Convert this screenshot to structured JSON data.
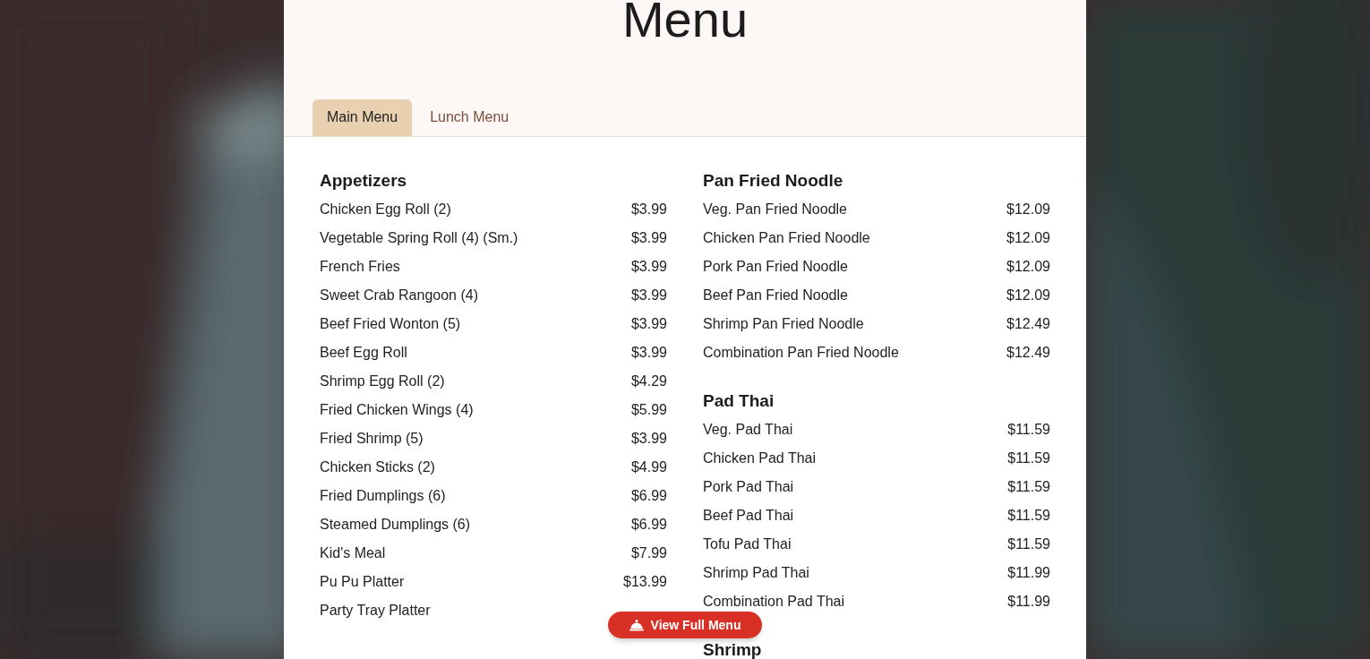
{
  "title": "Menu",
  "tabs": [
    {
      "label": "Main Menu",
      "selected": true
    },
    {
      "label": "Lunch Menu",
      "selected": false
    }
  ],
  "columns": [
    {
      "sections": [
        {
          "title": "Appetizers",
          "items": [
            {
              "name": "Chicken Egg Roll (2)",
              "price": "$3.99"
            },
            {
              "name": "Vegetable Spring Roll (4) (Sm.)",
              "price": "$3.99"
            },
            {
              "name": "French Fries",
              "price": "$3.99"
            },
            {
              "name": "Sweet Crab Rangoon (4)",
              "price": "$3.99"
            },
            {
              "name": "Beef Fried Wonton (5)",
              "price": "$3.99"
            },
            {
              "name": "Beef Egg Roll",
              "price": "$3.99"
            },
            {
              "name": "Shrimp Egg Roll (2)",
              "price": "$4.29"
            },
            {
              "name": "Fried Chicken Wings (4)",
              "price": "$5.99"
            },
            {
              "name": "Fried Shrimp (5)",
              "price": "$3.99"
            },
            {
              "name": "Chicken Sticks (2)",
              "price": "$4.99"
            },
            {
              "name": "Fried Dumplings (6)",
              "price": "$6.99"
            },
            {
              "name": "Steamed Dumplings (6)",
              "price": "$6.99"
            },
            {
              "name": "Kid's Meal",
              "price": "$7.99"
            },
            {
              "name": "Pu Pu Platter",
              "price": "$13.99"
            },
            {
              "name": "Party Tray Platter"
            }
          ]
        }
      ]
    },
    {
      "sections": [
        {
          "title": "Pan Fried Noodle",
          "items": [
            {
              "name": "Veg. Pan Fried Noodle",
              "price": "$12.09"
            },
            {
              "name": "Chicken Pan Fried Noodle",
              "price": "$12.09"
            },
            {
              "name": "Pork Pan Fried Noodle",
              "price": "$12.09"
            },
            {
              "name": "Beef Pan Fried Noodle",
              "price": "$12.09"
            },
            {
              "name": "Shrimp Pan Fried Noodle",
              "price": "$12.49"
            },
            {
              "name": "Combination Pan Fried Noodle",
              "price": "$12.49"
            }
          ]
        },
        {
          "title": "Pad Thai",
          "items": [
            {
              "name": "Veg. Pad Thai",
              "price": "$11.59"
            },
            {
              "name": "Chicken Pad Thai",
              "price": "$11.59"
            },
            {
              "name": "Pork Pad Thai",
              "price": "$11.59"
            },
            {
              "name": "Beef Pad Thai",
              "price": "$11.59"
            },
            {
              "name": "Tofu Pad Thai",
              "price": "$11.59"
            },
            {
              "name": "Shrimp Pad Thai",
              "price": "$11.99"
            },
            {
              "name": "Combination Pad Thai",
              "price": "$11.99"
            }
          ]
        },
        {
          "title": "Shrimp"
        }
      ]
    }
  ],
  "full_menu_button": {
    "label": "View Full Menu"
  }
}
